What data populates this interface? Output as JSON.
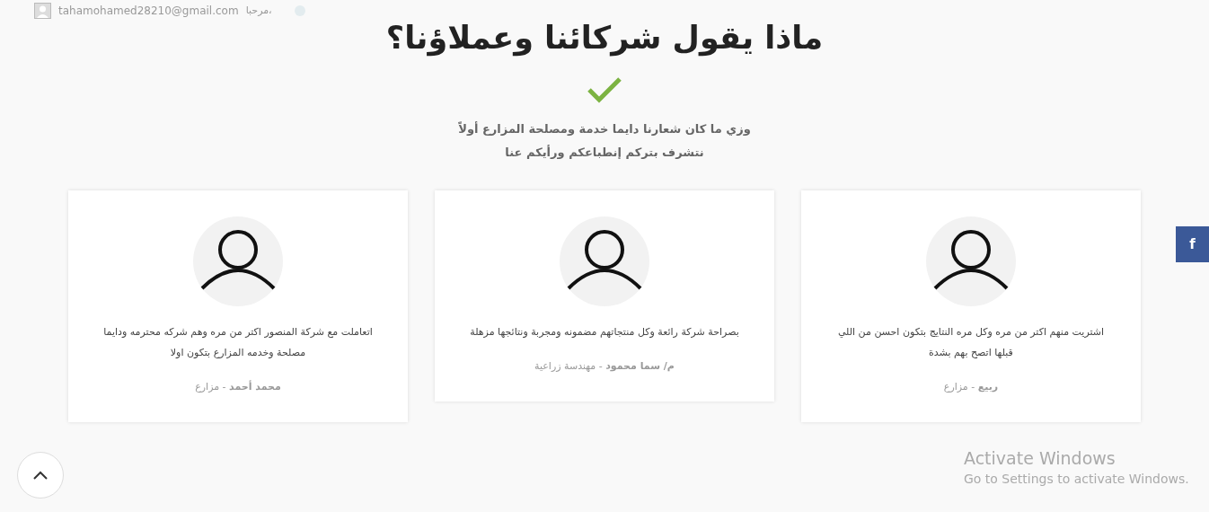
{
  "top_bar": {
    "email": "tahamohamed28210@gmail.com",
    "greeting": "مرحبا،"
  },
  "section": {
    "title": "ماذا يقول شركائنا وعملاؤنا؟",
    "subtitle_lines": [
      "وزي ما كان شعارنا دايما خدمة ومصلحة المزارع أولاً",
      "نتشرف بتركم إنطباعكم ورأيكم عنا"
    ]
  },
  "testimonials": [
    {
      "text": "اشتريت منهم اكتر من مره وكل مره النتايج بتكون احسن من اللي قبلها اتصح بهم بشدة",
      "author": "**ربيع** - مزارع"
    },
    {
      "text": "بصراحة شركة رائعة وكل منتجاتهم مضمونه ومجربة ونتائجها مزهلة",
      "author": "**م/ سما محمود** - مهندسة زراعية"
    },
    {
      "text": "اتعاملت مع شركة المنصور اكتر من مره وهم شركه محترمه ودايما مصلحة وخدمه المزارع بتكون اولا",
      "author": "**محمد أحمد** - مزارع"
    }
  ],
  "social": {
    "facebook_label": "f"
  },
  "activation_notice": {
    "title": "Activate Windows",
    "message": "Go to Settings to activate Windows."
  }
}
